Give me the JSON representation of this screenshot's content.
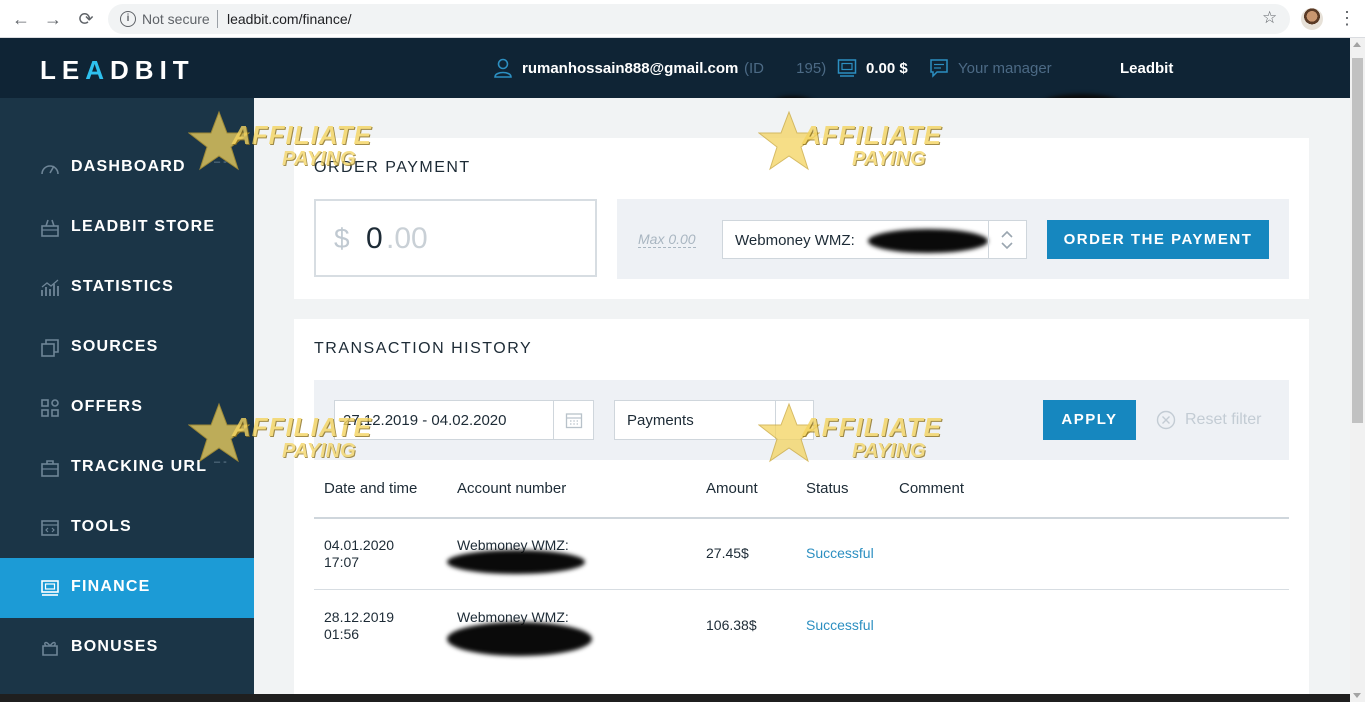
{
  "browser": {
    "security_label": "Not secure",
    "url": "leadbit.com/finance/",
    "back": "←",
    "forward": "→",
    "reload": "⟳",
    "star": "☆",
    "menu": "⋮"
  },
  "header": {
    "logo": {
      "l1": "LE",
      "a": "A",
      "l2": "DBIT"
    },
    "email": "rumanhossain888@gmail.com",
    "user_id_prefix": "(ID ",
    "user_id_suffix": "195)",
    "balance": "0.00 $",
    "manager_label": "Your manager",
    "manager_name": "Leadbit"
  },
  "sidebar": {
    "items": [
      {
        "label": "DASHBOARD",
        "icon": "gauge-icon"
      },
      {
        "label": "LEADBIT STORE",
        "icon": "basket-icon"
      },
      {
        "label": "STATISTICS",
        "icon": "bar-chart-icon"
      },
      {
        "label": "SOURCES",
        "icon": "layers-icon"
      },
      {
        "label": "OFFERS",
        "icon": "grid-icon"
      },
      {
        "label": "TRACKING URL",
        "icon": "briefcase-icon"
      },
      {
        "label": "TOOLS",
        "icon": "code-window-icon"
      },
      {
        "label": "FINANCE",
        "icon": "money-icon",
        "active": true
      },
      {
        "label": "BONUSES",
        "icon": "gift-icon"
      }
    ]
  },
  "order_payment": {
    "title": "ORDER PAYMENT",
    "currency": "$",
    "amount_int": "0",
    "amount_dec": ".00",
    "max_label": "Max 0.00",
    "wallet_selected": "Webmoney WMZ:",
    "button": "ORDER THE PAYMENT"
  },
  "transaction_history": {
    "title": "TRANSACTION HISTORY",
    "date_range": "27.12.2019 - 04.02.2020",
    "type_selected": "Payments",
    "apply": "APPLY",
    "reset": "Reset filter",
    "columns": [
      "Date and time",
      "Account number",
      "Amount",
      "Status",
      "Comment"
    ],
    "rows": [
      {
        "date": "04.01.2020",
        "time": "17:07",
        "account": "Webmoney WMZ:",
        "amount": "27.45$",
        "status": "Successful",
        "comment": ""
      },
      {
        "date": "28.12.2019",
        "time": "01:56",
        "account": "Webmoney WMZ:",
        "amount": "106.38$",
        "status": "Successful",
        "comment": ""
      }
    ]
  },
  "watermark": {
    "line1": "AFFILIATE",
    "line2": "PAYING"
  },
  "colors": {
    "sidebar_bg": "#1b3547",
    "header_bg": "#0f2435",
    "accent": "#1c9bd6",
    "button": "#1687bf",
    "status": "#2c8fc1"
  }
}
